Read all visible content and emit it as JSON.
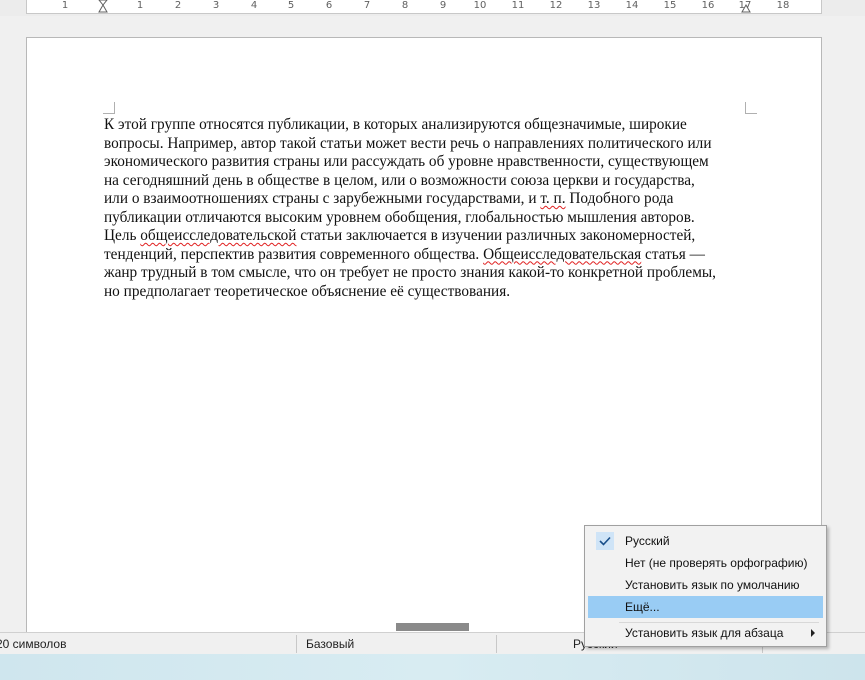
{
  "ruler": {
    "numbers": [
      "1",
      "1",
      "2",
      "3",
      "4",
      "5",
      "6",
      "7",
      "8",
      "9",
      "10",
      "11",
      "12",
      "13",
      "14",
      "15",
      "16",
      "17",
      "18"
    ]
  },
  "document": {
    "lines": [
      "К этой группе относятся публикации, в которых анализируются общезначимые, широкие",
      "вопросы. Например, автор такой статьи может вести речь о направлениях политического или",
      "экономического развития страны или рассуждать об уровне нравственности, существующем",
      "на сегодняшний день в обществе в целом, или о возможности союза церкви и государства,",
      "или о взаимоотношениях страны с зарубежными государствами, и т. п. Подобного рода",
      "публикации отличаются высоким уровнем обобщения, глобальностью мышления авторов.",
      "Цель общеисследовательской статьи заключается в изучении различных закономерностей,",
      "тенденций, перспектив развития современного общества. Общеисследовательская статья —",
      "жанр трудный в том смысле, что он требует не просто знания какой-то конкретной проблемы,",
      "но предполагает теоретическое объяснение её существования."
    ],
    "line5_pre": "или о взаимоотношениях страны с зарубежными государствами, и ",
    "line5_spell": "т. п.",
    "line5_post": " Подобного рода",
    "line7_pre": "Цель ",
    "line7_spell": "общеисследовательской",
    "line7_post": " статьи заключается в изучении различных закономерностей,",
    "line8_pre": "тенденций, перспектив развития современного общества. ",
    "line8_spell": "Общеисследовательская",
    "line8_post": " статья —"
  },
  "statusbar": {
    "char_count": "20 символов",
    "page_style": "Базовый",
    "language": "Русский"
  },
  "context_menu": {
    "items": [
      {
        "label": "Русский",
        "checked": true
      },
      {
        "label": "Нет (не проверять орфографию)"
      },
      {
        "label": "Установить язык по умолчанию"
      },
      {
        "label": "Ещё...",
        "highlighted": true
      },
      {
        "label": "Установить язык для абзаца",
        "submenu": true
      }
    ]
  },
  "colors": {
    "highlight": "#99ccf4",
    "spellcheck": "#e02020"
  }
}
